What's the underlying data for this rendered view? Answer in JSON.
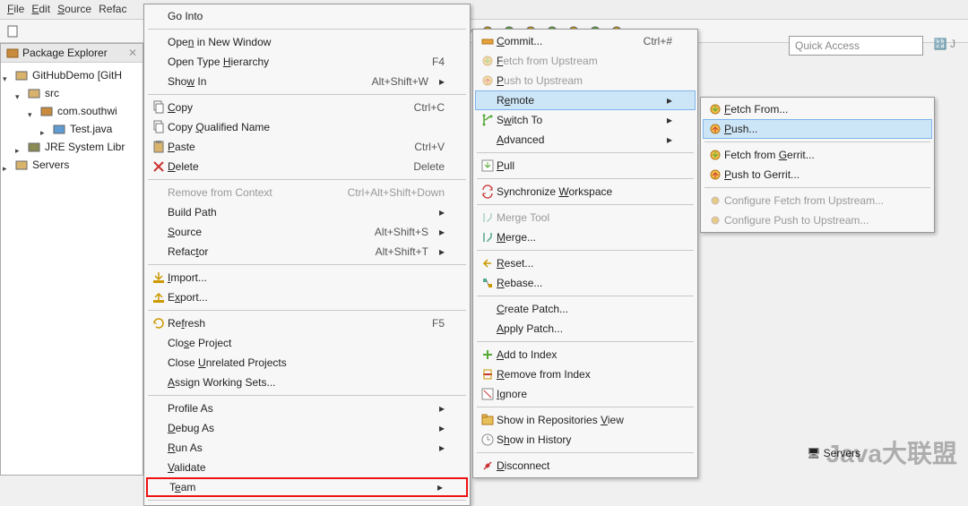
{
  "menubar": [
    "File",
    "Edit",
    "Source",
    "Refac"
  ],
  "quick_access": "Quick Access",
  "explorer": {
    "title": "Package Explorer",
    "items": [
      {
        "label": "GitHubDemo  [GitH",
        "level": 0,
        "open": true,
        "icon": "project"
      },
      {
        "label": "src",
        "level": 1,
        "open": true,
        "icon": "package-folder"
      },
      {
        "label": "com.southwi",
        "level": 2,
        "open": true,
        "icon": "package"
      },
      {
        "label": "Test.java",
        "level": 3,
        "open": false,
        "icon": "java"
      },
      {
        "label": "JRE System Libr",
        "level": 1,
        "open": false,
        "icon": "library"
      },
      {
        "label": "Servers",
        "level": 0,
        "open": false,
        "icon": "folder"
      }
    ]
  },
  "context_menu": [
    {
      "label": "Go Into"
    },
    {
      "sep": true
    },
    {
      "label": "Open in New Window",
      "u": "N"
    },
    {
      "label": "Open Type Hierarchy",
      "u": "H",
      "shortcut": "F4"
    },
    {
      "label": "Show In",
      "u": "W",
      "shortcut": "Alt+Shift+W",
      "arrow": true
    },
    {
      "sep": true
    },
    {
      "label": "Copy",
      "u": "C",
      "shortcut": "Ctrl+C",
      "icon": "copy"
    },
    {
      "label": "Copy Qualified Name",
      "u": "Q",
      "icon": "copy"
    },
    {
      "label": "Paste",
      "u": "P",
      "shortcut": "Ctrl+V",
      "icon": "paste"
    },
    {
      "label": "Delete",
      "u": "D",
      "shortcut": "Delete",
      "icon": "delete"
    },
    {
      "sep": true
    },
    {
      "label": "Remove from Context",
      "shortcut": "Ctrl+Alt+Shift+Down",
      "disabled": true
    },
    {
      "label": "Build Path",
      "arrow": true
    },
    {
      "label": "Source",
      "u": "S",
      "shortcut": "Alt+Shift+S",
      "arrow": true
    },
    {
      "label": "Refactor",
      "u": "T",
      "shortcut": "Alt+Shift+T",
      "arrow": true
    },
    {
      "sep": true
    },
    {
      "label": "Import...",
      "u": "I",
      "icon": "import"
    },
    {
      "label": "Export...",
      "u": "x",
      "icon": "export"
    },
    {
      "sep": true
    },
    {
      "label": "Refresh",
      "u": "F",
      "shortcut": "F5",
      "icon": "refresh"
    },
    {
      "label": "Close Project",
      "u": "s"
    },
    {
      "label": "Close Unrelated Projects",
      "u": "U"
    },
    {
      "label": "Assign Working Sets...",
      "u": "A"
    },
    {
      "sep": true
    },
    {
      "label": "Profile As",
      "arrow": true
    },
    {
      "label": "Debug As",
      "u": "D",
      "arrow": true
    },
    {
      "label": "Run As",
      "u": "R",
      "arrow": true
    },
    {
      "label": "Validate",
      "u": "V"
    },
    {
      "label": "Team",
      "u": "e",
      "arrow": true,
      "red": true
    },
    {
      "sep": true
    }
  ],
  "team_menu": [
    {
      "label": "Commit...",
      "u": "C",
      "shortcut": "Ctrl+#",
      "icon": "commit"
    },
    {
      "label": "Fetch from Upstream",
      "u": "F",
      "disabled": true,
      "icon": "fetch"
    },
    {
      "label": "Push to Upstream",
      "u": "P",
      "disabled": true,
      "icon": "push"
    },
    {
      "label": "Remote",
      "u": "e",
      "arrow": true,
      "hover": true,
      "red": true,
      "icon": ""
    },
    {
      "label": "Switch To",
      "u": "w",
      "arrow": true,
      "icon": "branch"
    },
    {
      "label": "Advanced",
      "u": "A",
      "arrow": true,
      "icon": ""
    },
    {
      "sep": true
    },
    {
      "label": "Pull",
      "u": "P",
      "icon": "pull"
    },
    {
      "sep": true
    },
    {
      "label": "Synchronize Workspace",
      "u": "W",
      "icon": "sync"
    },
    {
      "sep": true
    },
    {
      "label": "Merge Tool",
      "disabled": true,
      "icon": "merge"
    },
    {
      "label": "Merge...",
      "u": "M",
      "icon": "merge"
    },
    {
      "sep": true
    },
    {
      "label": "Reset...",
      "u": "R",
      "icon": "reset"
    },
    {
      "label": "Rebase...",
      "u": "R",
      "icon": "rebase"
    },
    {
      "sep": true
    },
    {
      "label": "Create Patch...",
      "u": "C"
    },
    {
      "label": "Apply Patch...",
      "u": "A"
    },
    {
      "sep": true
    },
    {
      "label": "Add to Index",
      "u": "A",
      "icon": "add"
    },
    {
      "label": "Remove from Index",
      "u": "R",
      "icon": "remove"
    },
    {
      "label": "Ignore",
      "u": "I",
      "icon": "ignore"
    },
    {
      "sep": true
    },
    {
      "label": "Show in Repositories View",
      "u": "V",
      "icon": "repo"
    },
    {
      "label": "Show in History",
      "u": "H",
      "icon": "history"
    },
    {
      "sep": true
    },
    {
      "label": "Disconnect",
      "u": "D",
      "icon": "disconnect"
    }
  ],
  "remote_menu": [
    {
      "label": "Fetch From...",
      "u": "F",
      "icon": "fetch"
    },
    {
      "label": "Push...",
      "u": "P",
      "hover": true,
      "red": true,
      "icon": "push"
    },
    {
      "sep": true
    },
    {
      "label": "Fetch from Gerrit...",
      "u": "G",
      "icon": "fetch"
    },
    {
      "label": "Push to Gerrit...",
      "u": "P",
      "icon": "push"
    },
    {
      "sep": true
    },
    {
      "label": "Configure Fetch from Upstream...",
      "disabled": true,
      "icon": "config"
    },
    {
      "label": "Configure Push to Upstream...",
      "disabled": true,
      "icon": "config"
    }
  ],
  "bottom_tabs": [
    "Servers"
  ],
  "watermark": "Java大联盟"
}
